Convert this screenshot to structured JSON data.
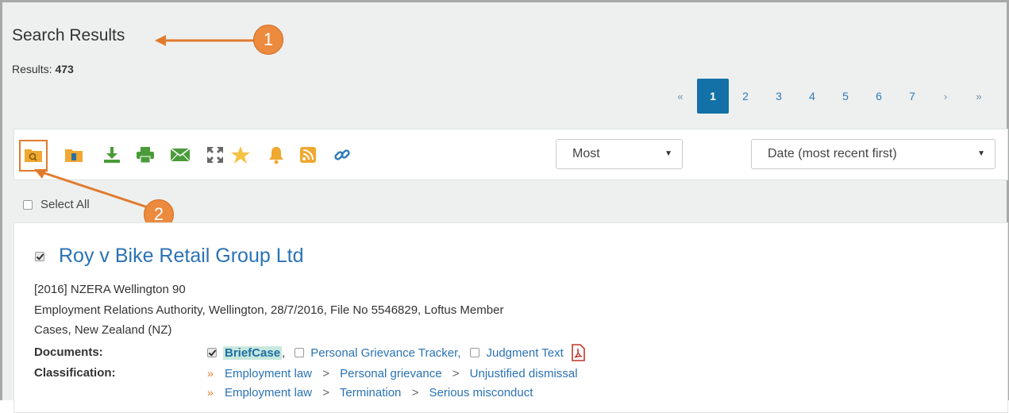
{
  "header": {
    "title": "Search Results",
    "results_label": "Results:",
    "results_count": "473"
  },
  "pager": {
    "first": "«",
    "pages": [
      "1",
      "2",
      "3",
      "4",
      "5",
      "6",
      "7"
    ],
    "next": "›",
    "last": "»",
    "active": "1"
  },
  "toolbar": {
    "icons": [
      "search-folder-icon",
      "folder-icon",
      "download-icon",
      "print-icon",
      "email-icon",
      "expand-icon",
      "star-icon",
      "bell-icon",
      "rss-icon",
      "link-icon"
    ],
    "show_select": "Most",
    "sort_select": "Date (most recent first)"
  },
  "select_all_label": "Select All",
  "result": {
    "title": "Roy v Bike Retail Group Ltd",
    "citation": "[2016] NZERA Wellington 90",
    "meta_line1": "Employment Relations Authority, Wellington, 28/7/2016, File No 5546829, Loftus Member",
    "meta_line2": "Cases, New Zealand (NZ)",
    "documents_label": "Documents:",
    "documents": [
      "BriefCase",
      "Personal Grievance Tracker,",
      "Judgment Text"
    ],
    "briefcase_comma": ",",
    "classification_label": "Classification:",
    "classification": [
      [
        "Employment law",
        "Personal grievance",
        "Unjustified dismissal"
      ],
      [
        "Employment law",
        "Termination",
        "Serious misconduct"
      ]
    ]
  },
  "annotations": [
    "1",
    "2"
  ],
  "colors": {
    "accent": "#1371a8",
    "link": "#2a72b5",
    "annotation": "#ec8a3e",
    "toolbar_icon": "#f0a830"
  }
}
